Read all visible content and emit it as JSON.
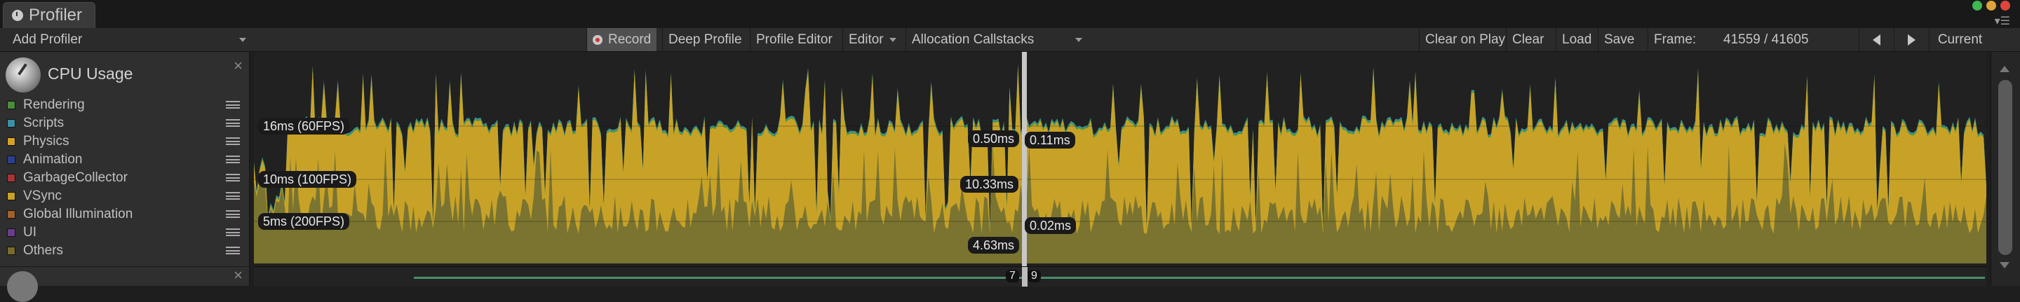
{
  "window": {
    "tab_title": "Profiler"
  },
  "toolbar": {
    "add_profiler": "Add Profiler",
    "record": "Record",
    "deep_profile": "Deep Profile",
    "profile_editor": "Profile Editor",
    "target": "Editor",
    "allocation_callstacks": "Allocation Callstacks",
    "clear_on_play": "Clear on Play",
    "clear": "Clear",
    "load": "Load",
    "save": "Save",
    "frame_label": "Frame:",
    "frame_value": "41559 / 41605",
    "current": "Current"
  },
  "module": {
    "title": "CPU Usage",
    "legend": [
      {
        "label": "Rendering",
        "color": "#4a8c3a"
      },
      {
        "label": "Scripts",
        "color": "#3c8fa8"
      },
      {
        "label": "Physics",
        "color": "#d4a224"
      },
      {
        "label": "Animation",
        "color": "#2b3f8f"
      },
      {
        "label": "GarbageCollector",
        "color": "#a23535"
      },
      {
        "label": "VSync",
        "color": "#c8a227"
      },
      {
        "label": "Global Illumination",
        "color": "#a0622d"
      },
      {
        "label": "UI",
        "color": "#6a3c8c"
      },
      {
        "label": "Others",
        "color": "#7a6b2a"
      }
    ]
  },
  "chart": {
    "threshold_labels": [
      "16ms (60FPS)",
      "10ms (100FPS)",
      "5ms (200FPS)"
    ],
    "left_values": [
      "0.50ms",
      "10.33ms",
      "4.63ms"
    ],
    "right_values": [
      "0.11ms",
      "0.02ms"
    ],
    "bottom_values": [
      "7",
      "9"
    ]
  },
  "colors": {
    "vsync": "#c8a227",
    "others": "#7a7430",
    "rendering": "#4a9a3a",
    "scripts": "#3c8fa8"
  }
}
